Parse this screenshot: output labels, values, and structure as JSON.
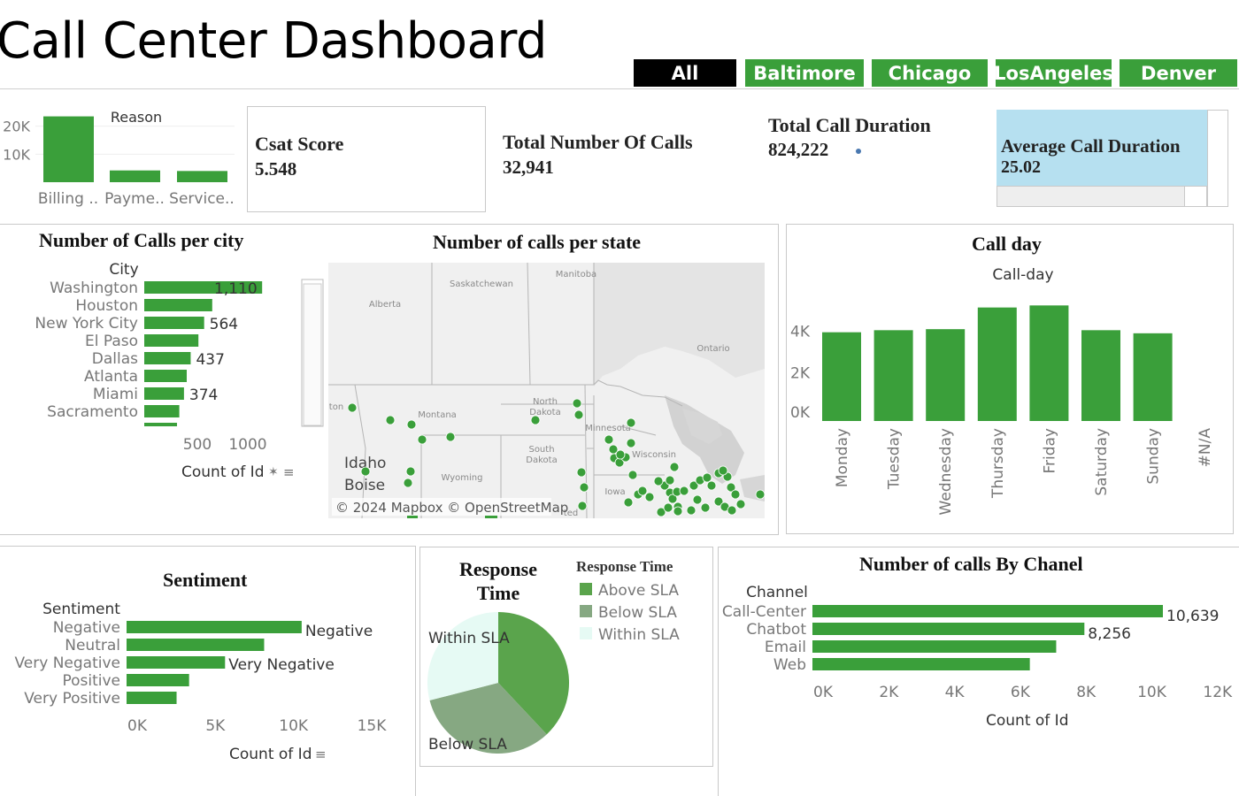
{
  "title": "Call Center Dashboard",
  "filters": [
    {
      "label": "All",
      "active": true
    },
    {
      "label": "Baltimore",
      "active": false
    },
    {
      "label": "Chicago",
      "active": false
    },
    {
      "label": "LosAngeles",
      "active": false
    },
    {
      "label": "Denver",
      "active": false
    }
  ],
  "kpis": {
    "csat": {
      "label": "Csat Score",
      "value": "5.548"
    },
    "total_calls": {
      "label": "Total Number Of Calls",
      "value": "32,941"
    },
    "total_duration": {
      "label": "Total Call Duration",
      "value": "824,222"
    },
    "avg_duration": {
      "label": "Average Call Duration",
      "value": "25.02"
    }
  },
  "colors": {
    "green": "#3a9f3a",
    "green_mid": "#5aa44c",
    "green_gray": "#86a882",
    "mint": "#e6faf4",
    "active_filter": "#000000",
    "highlight": "#b6e0f0"
  },
  "map": {
    "title": "Number of calls per state",
    "attribution": "© 2024 Mapbox © OpenStreetMap",
    "labels": {
      "saskatchewan": "Saskatchewan",
      "alberta": "Alberta",
      "manitoba": "Manitoba",
      "ontario": "Ontario",
      "north_dakota": "North Dakota",
      "montana": "Montana",
      "minnesota": "Minnesota",
      "south_dakota": "South Dakota",
      "wisconsin": "Wisconsin",
      "wyoming": "Wyoming",
      "iowa": "Iowa",
      "idaho": "Idaho",
      "boise": "Boise",
      "washington_cut": "ton",
      "united_cut": "ted"
    }
  },
  "chart_data": [
    {
      "id": "reason",
      "type": "bar",
      "title": "Reason",
      "categories": [
        "Billing ..",
        "Payme..",
        "Service.."
      ],
      "values": [
        23500,
        4200,
        4000
      ],
      "yticks": [
        "20K",
        "10K"
      ],
      "ylim": [
        0,
        24000
      ]
    },
    {
      "id": "calls_per_city",
      "type": "bar",
      "orientation": "horizontal",
      "title": "Number of Calls per city",
      "ylabel": "City",
      "xlabel": "Count of Id",
      "categories": [
        "Washington",
        "Houston",
        "New York City",
        "El Paso",
        "Dallas",
        "Atlanta",
        "Miami",
        "Sacramento"
      ],
      "values": [
        1110,
        640,
        564,
        510,
        437,
        400,
        374,
        330
      ],
      "data_labels": [
        "1,110",
        "",
        "564",
        "",
        "437",
        "",
        "374",
        ""
      ],
      "xticks": [
        "500",
        "1000"
      ],
      "xlim": [
        0,
        1200
      ]
    },
    {
      "id": "call_day",
      "type": "bar",
      "title": "Call day",
      "subtitle": "Call-day",
      "categories": [
        "Monday",
        "Tuesday",
        "Wednesday",
        "Thursday",
        "Friday",
        "Saturday",
        "Sunday",
        "#N/A"
      ],
      "values": [
        4300,
        4400,
        4450,
        5500,
        5600,
        4400,
        4250,
        0
      ],
      "yticks": [
        "4K",
        "2K",
        "0K"
      ],
      "ylim": [
        0,
        6000
      ]
    },
    {
      "id": "sentiment",
      "type": "bar",
      "orientation": "horizontal",
      "title": "Sentiment",
      "ylabel": "Sentiment",
      "xlabel": "Count of Id",
      "categories": [
        "Negative",
        "Neutral",
        "Very Negative",
        "Positive",
        "Very Positive"
      ],
      "values": [
        11200,
        8800,
        6300,
        4000,
        3200
      ],
      "data_labels": [
        "Negative",
        "",
        "Very Negative",
        "",
        ""
      ],
      "xticks": [
        "0K",
        "5K",
        "10K",
        "15K"
      ],
      "xlim": [
        0,
        17000
      ]
    },
    {
      "id": "response_time",
      "type": "pie",
      "title": "Response Time",
      "legend_title": "Response Time",
      "legend": [
        "Above SLA",
        "Below SLA",
        "Within SLA"
      ],
      "values": [
        38,
        33,
        29
      ],
      "slice_labels": [
        "",
        "Below SLA",
        "Within SLA"
      ]
    },
    {
      "id": "calls_by_channel",
      "type": "bar",
      "orientation": "horizontal",
      "title": "Number of calls By Chanel",
      "ylabel": "Channel",
      "xlabel": "Count of Id",
      "categories": [
        "Call-Center",
        "Chatbot",
        "Email",
        "Web"
      ],
      "values": [
        10639,
        8256,
        7400,
        6600
      ],
      "data_labels": [
        "10,639",
        "8,256",
        "",
        ""
      ],
      "xticks": [
        "0K",
        "2K",
        "4K",
        "6K",
        "8K",
        "10K",
        "12K"
      ],
      "xlim": [
        0,
        12800
      ]
    }
  ]
}
